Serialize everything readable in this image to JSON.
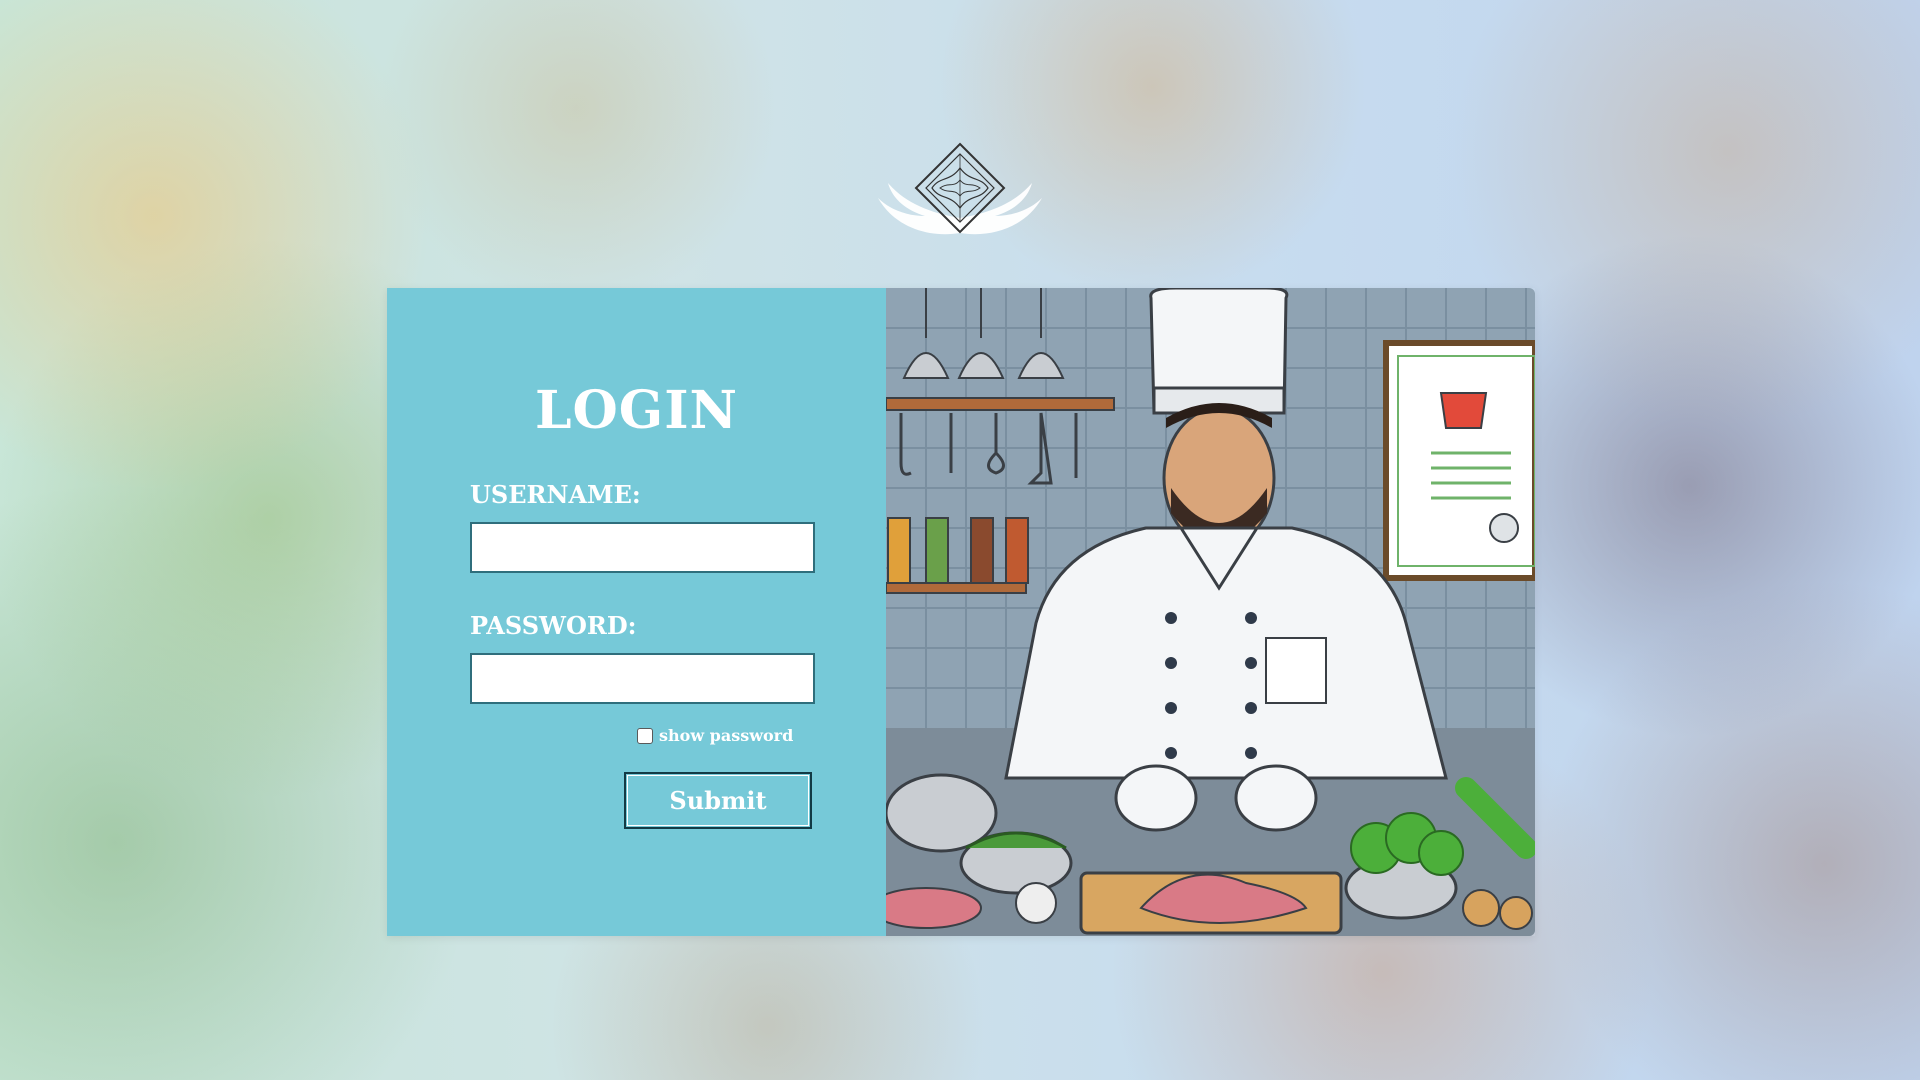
{
  "page": {
    "background": "blurred-food-photo"
  },
  "logo": {
    "icon": "winged-diamond-logo-icon"
  },
  "login": {
    "title": "LOGIN",
    "username_label": "USERNAME:",
    "username_value": "",
    "password_label": "PASSWORD:",
    "password_value": "",
    "show_password_label": "show password",
    "show_password_checked": false,
    "submit_label": "Submit"
  },
  "illustration": {
    "subject": "chef-illustration"
  },
  "colors": {
    "panel": "#76c9d8",
    "text": "#ffffff",
    "button_border": "#123a45"
  }
}
